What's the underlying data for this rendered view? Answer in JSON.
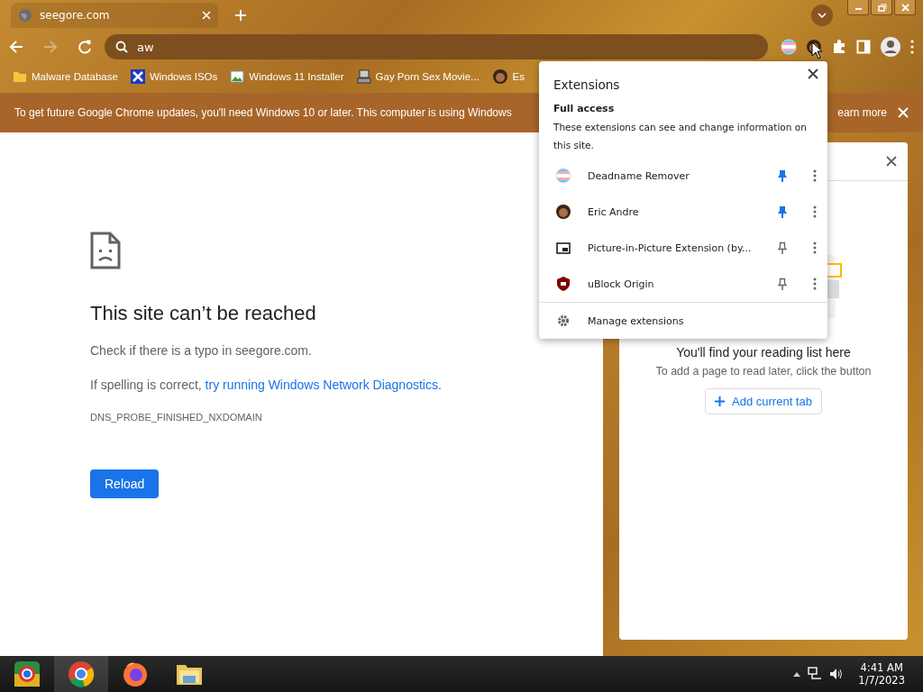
{
  "tabs": [
    {
      "title": "seegore.com",
      "selected": true
    }
  ],
  "toolbar": {
    "address": "aw",
    "pinned_extensions": [
      {
        "kind": "flag"
      },
      {
        "kind": "avatar"
      }
    ]
  },
  "bookmarks": [
    {
      "label": "Malware Database",
      "kind": "folder"
    },
    {
      "label": "Windows ISOs",
      "kind": "x"
    },
    {
      "label": "Windows 11 Installer",
      "kind": "image"
    },
    {
      "label": "Gay Porn Sex Movie...",
      "kind": "computer"
    },
    {
      "label": "Es",
      "kind": "avatar"
    }
  ],
  "infobar": {
    "message": "To get future Google Chrome updates, you'll need Windows 10 or later. This computer is using Windows",
    "link": "earn more"
  },
  "error_page": {
    "title": "This site can’t be reached",
    "lines": [
      {
        "text": "Check if there is a typo in seegore.com."
      },
      {
        "text": "If spelling is correct, ",
        "link": "try running Windows Network Diagnostics",
        "after": "."
      }
    ],
    "code": "DNS_PROBE_FINISHED_NXDOMAIN",
    "button": "Reload"
  },
  "reading_list": {
    "heading": "You'll find your reading list here",
    "subtext": "To add a page to read later, click the button",
    "button": "Add current tab"
  },
  "extensions_menu": {
    "title": "Extensions",
    "section": "Full access",
    "description": "These extensions can see and change information on this site.",
    "items": [
      {
        "name": "Deadname Remover",
        "kind": "flag",
        "pinned": true
      },
      {
        "name": "Eric Andre",
        "kind": "avatar",
        "pinned": true
      },
      {
        "name": "Picture-in-Picture Extension (by...",
        "kind": "pip",
        "pinned": false
      },
      {
        "name": "uBlock Origin",
        "kind": "shield",
        "pinned": false
      }
    ],
    "manage": "Manage extensions"
  },
  "taskbar": {
    "apps": [
      {
        "kind": "chromium",
        "selected": false
      },
      {
        "kind": "chrome",
        "selected": true
      },
      {
        "kind": "firefox",
        "selected": false
      },
      {
        "kind": "folder",
        "selected": false
      }
    ],
    "time": "4:41 AM",
    "date": "1/7/2023"
  }
}
